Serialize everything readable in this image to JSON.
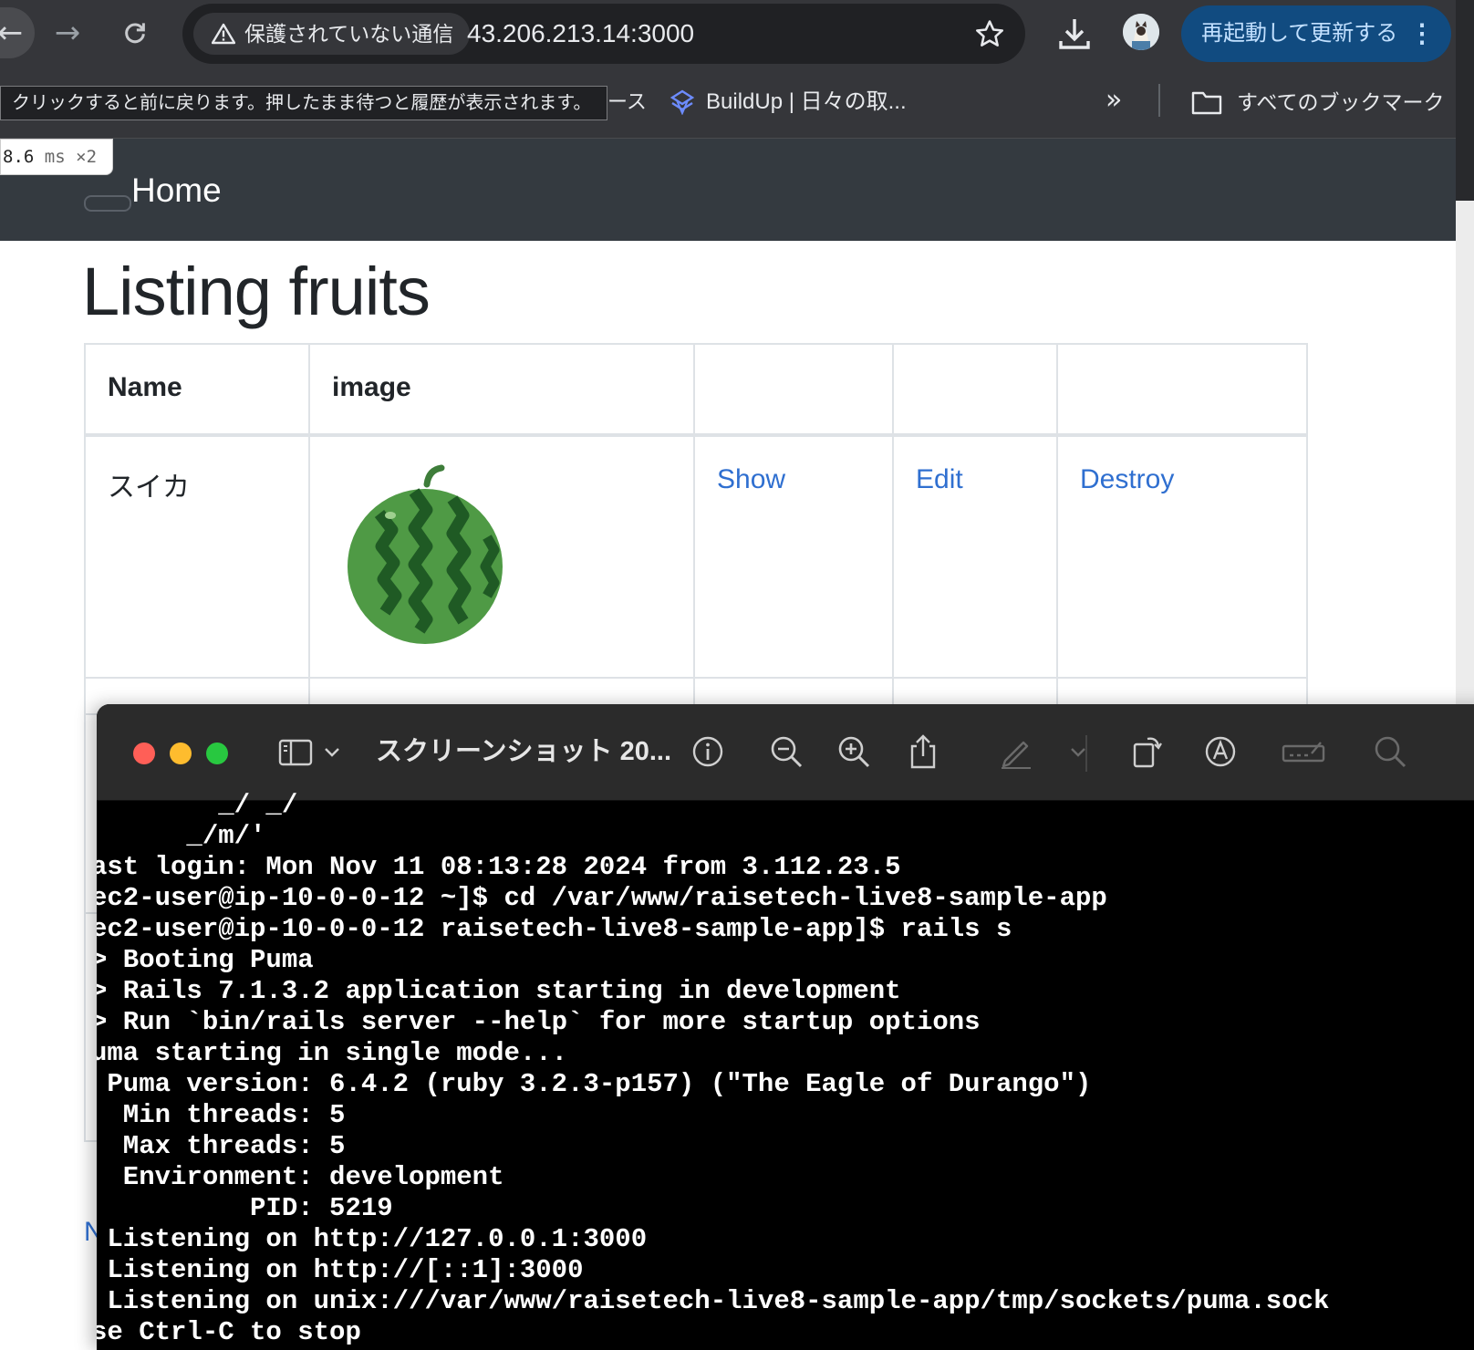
{
  "browser": {
    "security_label": "保護されていない通信",
    "url": "43.206.213.14:3000",
    "update_label": "再起動して更新する",
    "tooltip": "クリックすると前に戻ります。押したまま待つと履歴が表示されます。",
    "bookmarks": {
      "partial_label": "ース",
      "buildup_label": "BuildUp | 日々の取...",
      "all_bookmarks_label": "すべてのブックマーク"
    }
  },
  "perf_badge": {
    "value": "8.6",
    "unit": "ms",
    "count": "×2"
  },
  "app": {
    "nav_home": "Home",
    "page_title": "Listing fruits",
    "table": {
      "headers": [
        "Name",
        "image",
        "",
        "",
        ""
      ],
      "rows": [
        {
          "name": "スイカ",
          "image_icon": "watermelon-image",
          "show": "Show",
          "edit": "Edit",
          "destroy": "Destroy"
        }
      ]
    },
    "partial_link_letter": "N"
  },
  "preview": {
    "title": "スクリーンショット 20..."
  },
  "terminal": {
    "lines": [
      "        _/ _/",
      "      _/m/'",
      "ast login: Mon Nov 11 08:13:28 2024 from 3.112.23.5",
      "ec2-user@ip-10-0-0-12 ~]$ cd /var/www/raisetech-live8-sample-app",
      "ec2-user@ip-10-0-0-12 raisetech-live8-sample-app]$ rails s",
      "> Booting Puma",
      "> Rails 7.1.3.2 application starting in development",
      "> Run `bin/rails server --help` for more startup options",
      "uma starting in single mode...",
      " Puma version: 6.4.2 (ruby 3.2.3-p157) (\"The Eagle of Durango\")",
      "  Min threads: 5",
      "  Max threads: 5",
      "  Environment: development",
      "          PID: 5219",
      " Listening on http://127.0.0.1:3000",
      " Listening on http://[::1]:3000",
      " Listening on unix:///var/www/raisetech-live8-sample-app/tmp/sockets/puma.sock",
      "se Ctrl-C to stop"
    ]
  },
  "colors": {
    "chrome_bg": "#35363a",
    "navbar_bg": "#343a40",
    "link": "#2f6fd0",
    "update_btn": "#114b80"
  }
}
